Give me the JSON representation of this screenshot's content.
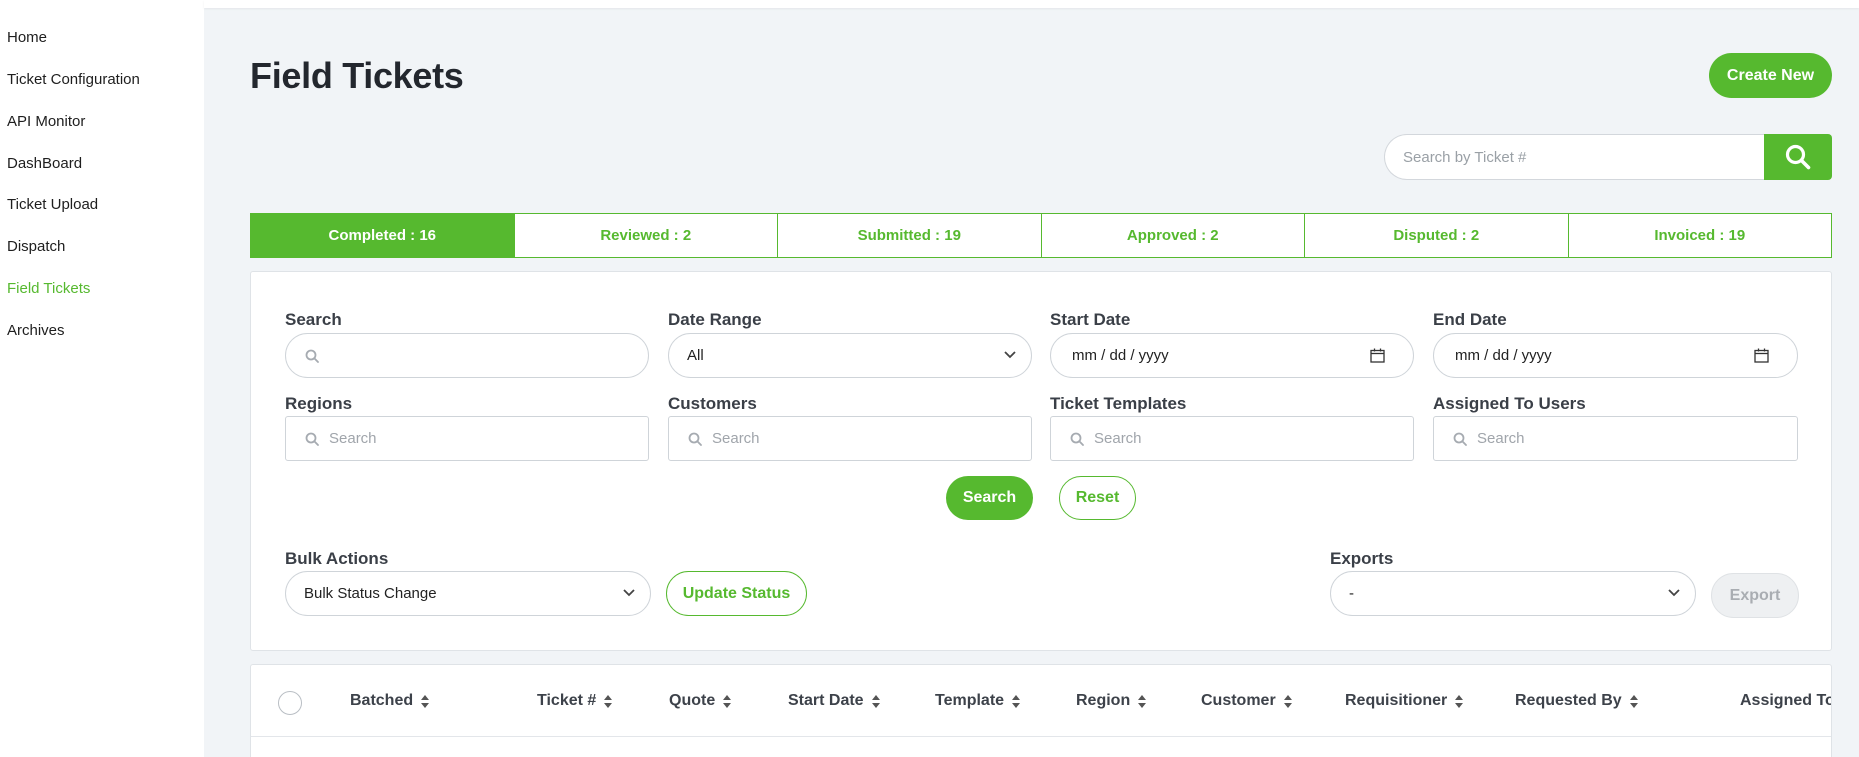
{
  "sidebar": {
    "items": [
      {
        "label": "Home",
        "active": false
      },
      {
        "label": "Ticket Configuration",
        "active": false
      },
      {
        "label": "API Monitor",
        "active": false
      },
      {
        "label": "DashBoard",
        "active": false
      },
      {
        "label": "Ticket Upload",
        "active": false
      },
      {
        "label": "Dispatch",
        "active": false
      },
      {
        "label": "Field Tickets",
        "active": true
      },
      {
        "label": "Archives",
        "active": false
      }
    ]
  },
  "header": {
    "title": "Field Tickets",
    "create_button": "Create New",
    "ticket_search_placeholder": "Search by Ticket #",
    "search_icon": "search-icon"
  },
  "status_tabs": [
    {
      "label": "Completed : 16",
      "active": true
    },
    {
      "label": "Reviewed : 2",
      "active": false
    },
    {
      "label": "Submitted : 19",
      "active": false
    },
    {
      "label": "Approved : 2",
      "active": false
    },
    {
      "label": "Disputed : 2",
      "active": false
    },
    {
      "label": "Invoiced : 19",
      "active": false
    }
  ],
  "filters": {
    "search_label": "Search",
    "date_range_label": "Date Range",
    "date_range_value": "All",
    "start_date_label": "Start Date",
    "start_date_value": "mm / dd / yyyy",
    "end_date_label": "End Date",
    "end_date_value": "mm / dd / yyyy",
    "regions_label": "Regions",
    "regions_placeholder": "Search",
    "customers_label": "Customers",
    "customers_placeholder": "Search",
    "templates_label": "Ticket Templates",
    "templates_placeholder": "Search",
    "assigned_label": "Assigned To Users",
    "assigned_placeholder": "Search",
    "search_button": "Search",
    "reset_button": "Reset",
    "bulk_actions_label": "Bulk Actions",
    "bulk_actions_value": "Bulk Status Change",
    "update_status_button": "Update Status",
    "exports_label": "Exports",
    "exports_value": "-",
    "export_button": "Export"
  },
  "table": {
    "columns": [
      "Batched",
      "Ticket #",
      "Quote",
      "Start Date",
      "Template",
      "Region",
      "Customer",
      "Requisitioner",
      "Requested By",
      "Assigned To"
    ]
  },
  "colors": {
    "accent": "#56b92f",
    "background": "#f1f4f7"
  }
}
